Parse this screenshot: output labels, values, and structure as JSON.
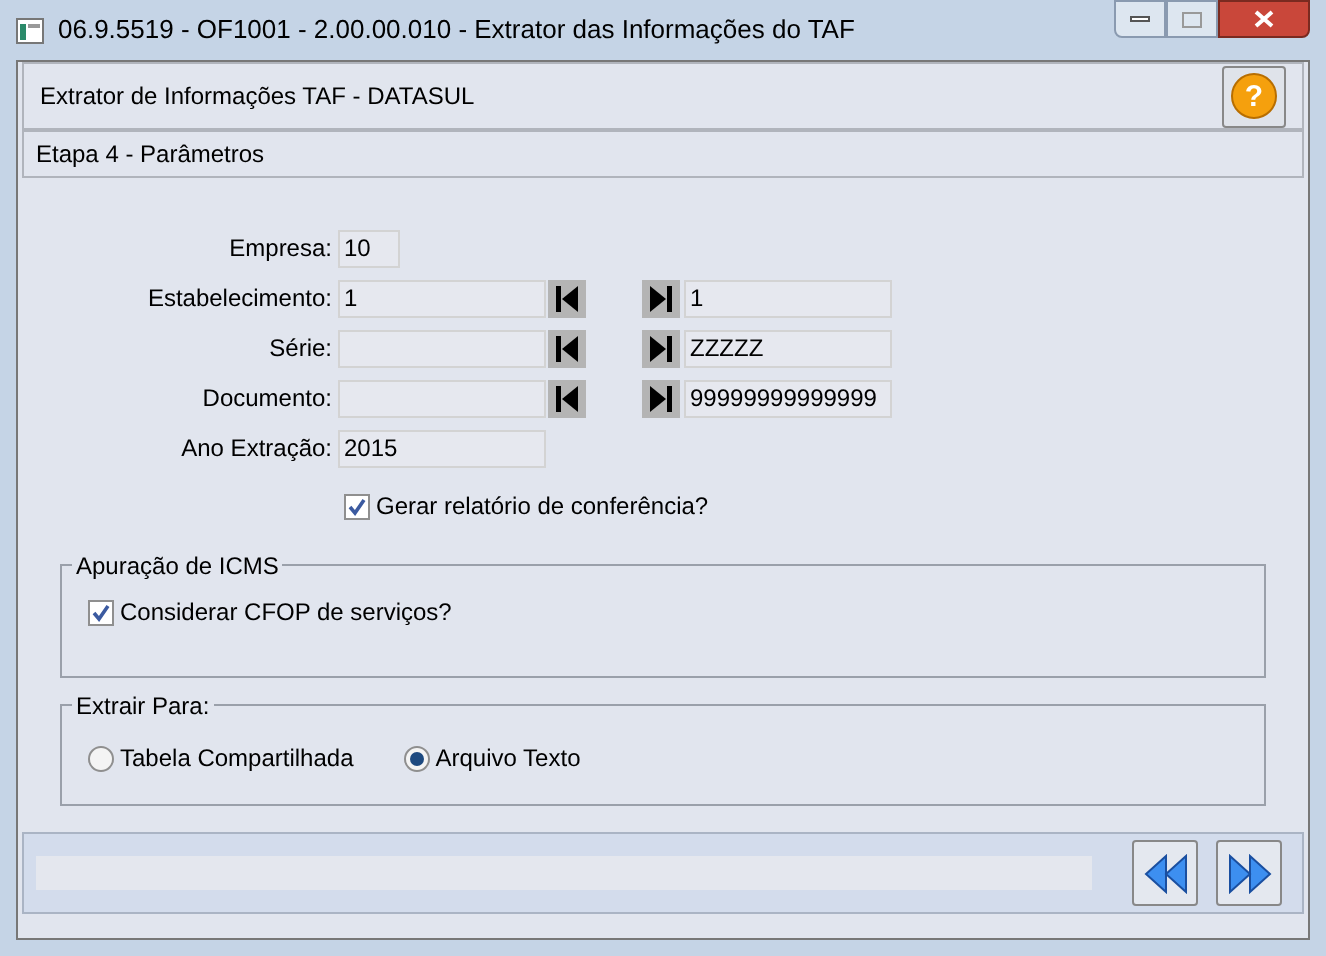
{
  "window": {
    "title": "06.9.5519 - OF1001 - 2.00.00.010 - Extrator das Informações do TAF"
  },
  "header": {
    "title": "Extrator de Informações TAF - DATASUL",
    "help_label": "?"
  },
  "step": {
    "title": "Etapa 4 - Parâmetros"
  },
  "fields": [
    {
      "kind": "single",
      "label": "Empresa:",
      "value": "10"
    },
    {
      "kind": "range",
      "label": "Estabelecimento:",
      "from": "1",
      "to": "1"
    },
    {
      "kind": "range",
      "label": "Série:",
      "to": "ZZZZZ"
    },
    {
      "kind": "range",
      "label": "Documento:",
      "to": "99999999999999"
    },
    {
      "kind": "single",
      "label": "Ano Extração:",
      "value": "2015"
    }
  ],
  "report_checkbox": {
    "label": "Gerar relatório de conferência?",
    "checked": true
  },
  "icms_group": {
    "title": "Apuração de ICMS",
    "checkbox": {
      "label": "Considerar CFOP de serviços?",
      "checked": true
    }
  },
  "extract_group": {
    "title": "Extrair Para:",
    "options": [
      {
        "label": "Tabela Compartilhada",
        "selected": false
      },
      {
        "label": "Arquivo Texto",
        "selected": true
      }
    ]
  }
}
